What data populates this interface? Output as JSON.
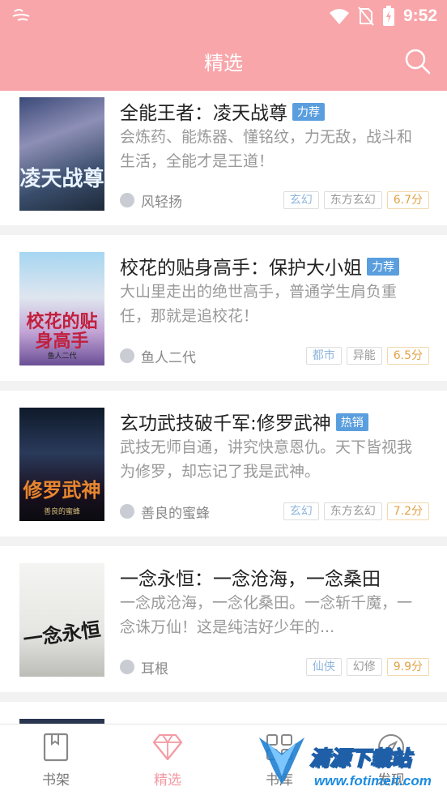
{
  "status": {
    "time": "9:52"
  },
  "header": {
    "title": "精选"
  },
  "books": [
    {
      "title": "全能王者：凌天战尊",
      "badge": "力荐",
      "desc": "会炼药、能炼器、懂铭纹，力无敌，战斗和生活，全能才是王道！",
      "author": "风轻扬",
      "tags": [
        "玄幻",
        "东方玄幻"
      ],
      "score": "6.7分",
      "cover_title": "凌天战尊"
    },
    {
      "title": "校花的贴身高手：保护大小姐",
      "badge": "力荐",
      "desc": "大山里走出的绝世高手，普通学生肩负重任，那就是追校花！",
      "author": "鱼人二代",
      "tags": [
        "都市",
        "异能"
      ],
      "score": "6.5分",
      "cover_title": "校花的贴身高手",
      "cover_author": "鱼人二代"
    },
    {
      "title": "玄功武技破千军:修罗武神",
      "badge": "热销",
      "desc": "武技无师自通，讲究快意恩仇。天下皆视我为修罗，却忘记了我是武神。",
      "author": "善良的蜜蜂",
      "tags": [
        "玄幻",
        "东方玄幻"
      ],
      "score": "7.2分",
      "cover_title": "修罗武神",
      "cover_author": "善良的蜜蜂"
    },
    {
      "title": "一念永恒：一念沧海，一念桑田",
      "badge": "",
      "desc": "一念成沧海，一念化桑田。一念斩千魔，一念诛万仙！这是纯洁好少年的...",
      "author": "耳根",
      "tags": [
        "仙侠",
        "幻修"
      ],
      "score": "9.9分",
      "cover_title": "一念永恒"
    }
  ],
  "tabs": [
    {
      "label": "书架"
    },
    {
      "label": "精选"
    },
    {
      "label": "书库"
    },
    {
      "label": "发现"
    }
  ],
  "watermark": {
    "title": "清源下载站",
    "url": "www.fotimeit.com"
  },
  "colors": {
    "header": "#f8a6aa",
    "accent": "#f39aa3",
    "badge": "#5a9ede",
    "score": "#e2a244"
  }
}
